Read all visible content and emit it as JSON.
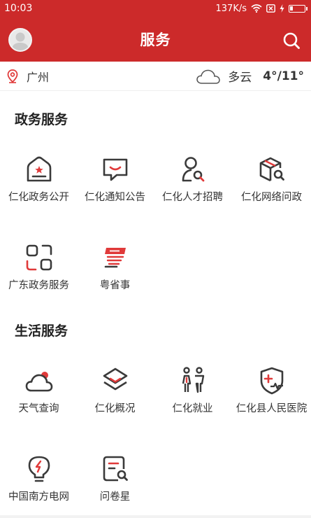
{
  "status_bar": {
    "time": "10:03",
    "speed": "137K/s"
  },
  "header": {
    "title": "服务"
  },
  "location": {
    "city": "广州",
    "condition": "多云",
    "temperature": "4°/11°"
  },
  "sections": [
    {
      "title": "政务服务",
      "items": [
        {
          "label": "仁化政务公开",
          "icon": "government-building-icon"
        },
        {
          "label": "仁化通知公告",
          "icon": "message-bubble-icon"
        },
        {
          "label": "仁化人才招聘",
          "icon": "person-search-icon"
        },
        {
          "label": "仁化网络问政",
          "icon": "box-search-icon"
        },
        {
          "label": "广东政务服务",
          "icon": "app-grid-icon"
        },
        {
          "label": "粤省事",
          "icon": "yue-shengshi-logo-icon"
        }
      ]
    },
    {
      "title": "生活服务",
      "items": [
        {
          "label": "天气查询",
          "icon": "cloud-sun-icon"
        },
        {
          "label": "仁化概况",
          "icon": "layers-icon"
        },
        {
          "label": "仁化就业",
          "icon": "people-icon"
        },
        {
          "label": "仁化县人民医院",
          "icon": "medical-shield-icon"
        },
        {
          "label": "中国南方电网",
          "icon": "lightbulb-icon"
        },
        {
          "label": "问卷星",
          "icon": "document-search-icon"
        }
      ]
    }
  ],
  "colors": {
    "brand_red": "#cc2a2a",
    "icon_dark": "#3a3a3a",
    "accent_red": "#e03a3a"
  }
}
